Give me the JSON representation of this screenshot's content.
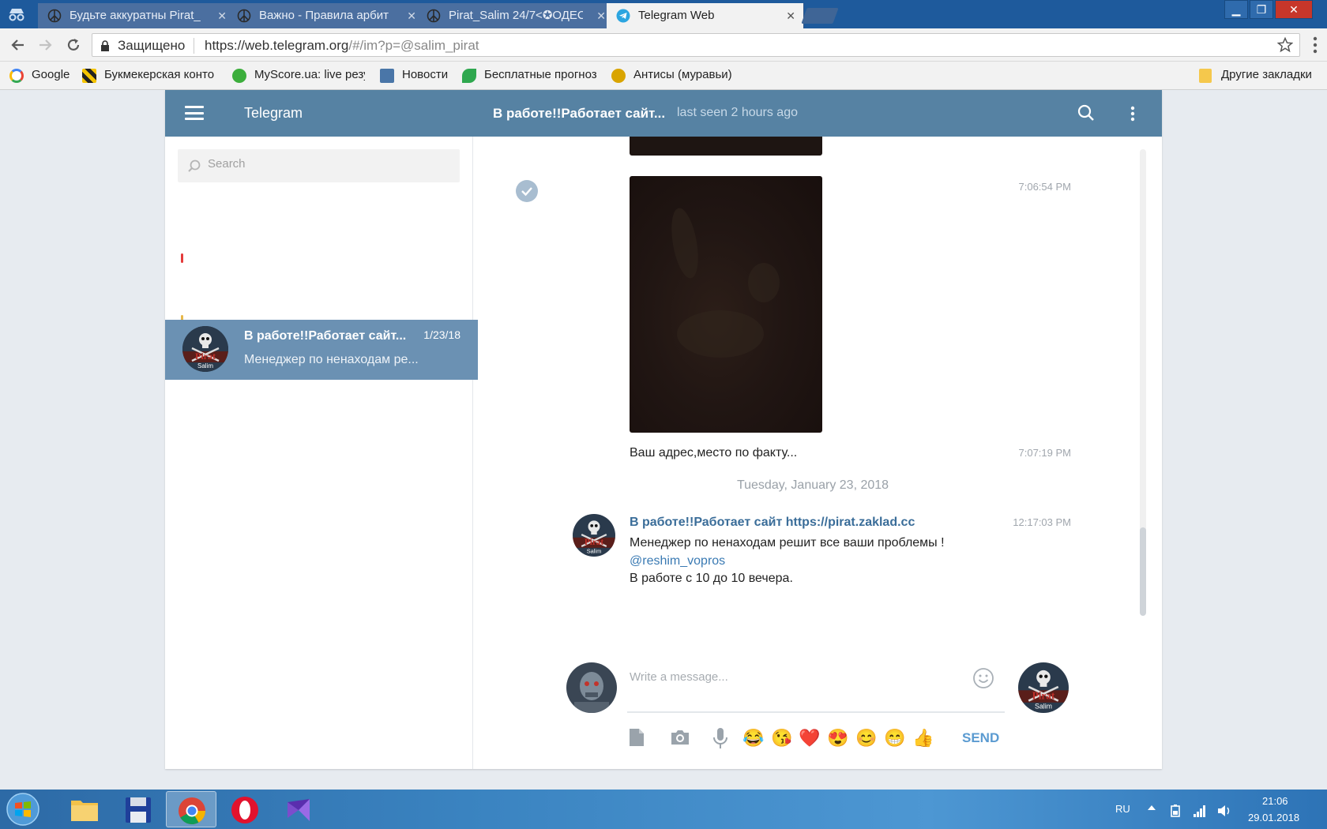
{
  "browser": {
    "tabs": [
      {
        "title": "Будьте аккуратны Pirat_",
        "icon": "peace-icon",
        "active": false
      },
      {
        "title": "Важно - Правила арбит",
        "icon": "peace-icon",
        "active": false
      },
      {
        "title": "Pirat_Salim 24/7<✪ОДЕС",
        "icon": "peace-icon",
        "active": false
      },
      {
        "title": "Telegram Web",
        "icon": "telegram-icon",
        "active": true
      }
    ],
    "tab_close": "✕",
    "window_controls": {
      "minimize": "▁",
      "maximize": "❐",
      "close": "✕"
    },
    "address": {
      "secure_label": "Защищено",
      "url_host": "https://web.telegram.org",
      "url_rest": "/#/im?p=@salim_pirat"
    },
    "bookmarks": [
      {
        "label": "Google",
        "color": "#4285f4"
      },
      {
        "label": "Букмекерская конто",
        "color": "#f5c400"
      },
      {
        "label": "MyScore.ua: live резу",
        "color": "#3cae3c"
      },
      {
        "label": "Новости",
        "color": "#4a76a8"
      },
      {
        "label": "Бесплатные прогноз",
        "color": "#2fa84f"
      },
      {
        "label": "Антисы (муравьи)",
        "color": "#d9a400"
      }
    ],
    "other_bookmarks": "Другие закладки"
  },
  "telegram": {
    "brand": "Telegram",
    "peer_title": "В работе!!Работает сайт...",
    "peer_status": "last seen 2 hours ago",
    "search_placeholder": "Search",
    "dialog": {
      "name": "В работе!!Работает сайт...",
      "date": "1/23/18",
      "preview": "Менеджер по ненаходам ре..."
    },
    "messages": {
      "photo_time": "7:06:54 PM",
      "address_text": "Ваш адрес,место по факту...",
      "address_time": "7:07:19 PM",
      "date_separator": "Tuesday, January 23, 2018",
      "author": "В работе!!Работает сайт https://pirat.zaklad.cc",
      "author_time": "12:17:03 PM",
      "line1": "Менеджер по ненаходам решит все ваши  проблемы !",
      "mention": "@reshim_vopros",
      "line3": "В работе с 10  до 10 вечера."
    },
    "composer": {
      "placeholder": "Write a message...",
      "emojis": [
        "😂",
        "😘",
        "❤️",
        "😍",
        "😊",
        "😁",
        "👍"
      ],
      "send_label": "SEND"
    },
    "accent_color": "#5682a3"
  },
  "taskbar": {
    "lang": "RU",
    "time": "21:06",
    "date": "29.01.2018"
  }
}
